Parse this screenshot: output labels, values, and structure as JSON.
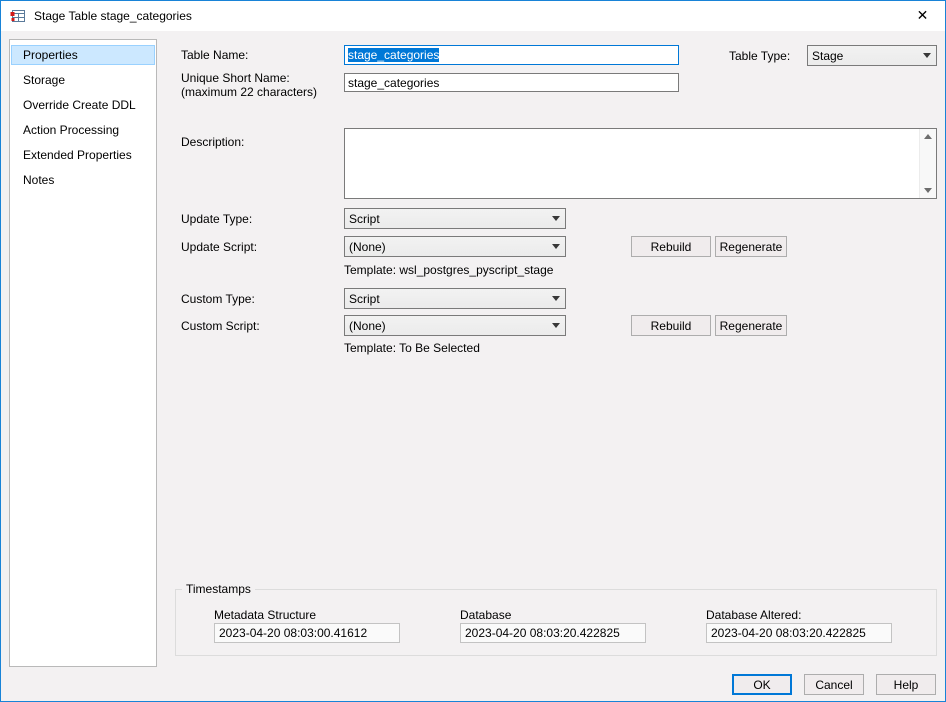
{
  "window": {
    "title": "Stage Table stage_categories",
    "close_icon": "✕"
  },
  "sidebar": {
    "items": [
      {
        "label": "Properties",
        "selected": true
      },
      {
        "label": "Storage",
        "selected": false
      },
      {
        "label": "Override Create DDL",
        "selected": false
      },
      {
        "label": "Action Processing",
        "selected": false
      },
      {
        "label": "Extended Properties",
        "selected": false
      },
      {
        "label": "Notes",
        "selected": false
      }
    ]
  },
  "form": {
    "table_name": {
      "label": "Table Name:",
      "value": "stage_categories"
    },
    "table_type": {
      "label": "Table Type:",
      "value": "Stage"
    },
    "unique_short_name": {
      "label_line1": "Unique Short Name:",
      "label_line2": "(maximum 22 characters)",
      "value": "stage_categories"
    },
    "description": {
      "label": "Description:",
      "value": ""
    },
    "update_type": {
      "label": "Update Type:",
      "value": "Script"
    },
    "update_script": {
      "label": "Update Script:",
      "value": "(None)",
      "rebuild_label": "Rebuild",
      "regenerate_label": "Regenerate",
      "template": "Template: wsl_postgres_pyscript_stage"
    },
    "custom_type": {
      "label": "Custom Type:",
      "value": "Script"
    },
    "custom_script": {
      "label": "Custom Script:",
      "value": "(None)",
      "rebuild_label": "Rebuild",
      "regenerate_label": "Regenerate",
      "template": "Template: To Be Selected"
    }
  },
  "timestamps": {
    "group_label": "Timestamps",
    "fields": [
      {
        "label": "Metadata Structure",
        "value": "2023-04-20 08:03:00.41612"
      },
      {
        "label": "Database",
        "value": "2023-04-20 08:03:20.422825"
      },
      {
        "label": "Database Altered:",
        "value": "2023-04-20 08:03:20.422825"
      }
    ]
  },
  "footer": {
    "ok_label": "OK",
    "cancel_label": "Cancel",
    "help_label": "Help"
  },
  "colors": {
    "accent": "#0078d7",
    "selection_bg": "#cce8ff",
    "selection_border": "#99d1ff"
  }
}
